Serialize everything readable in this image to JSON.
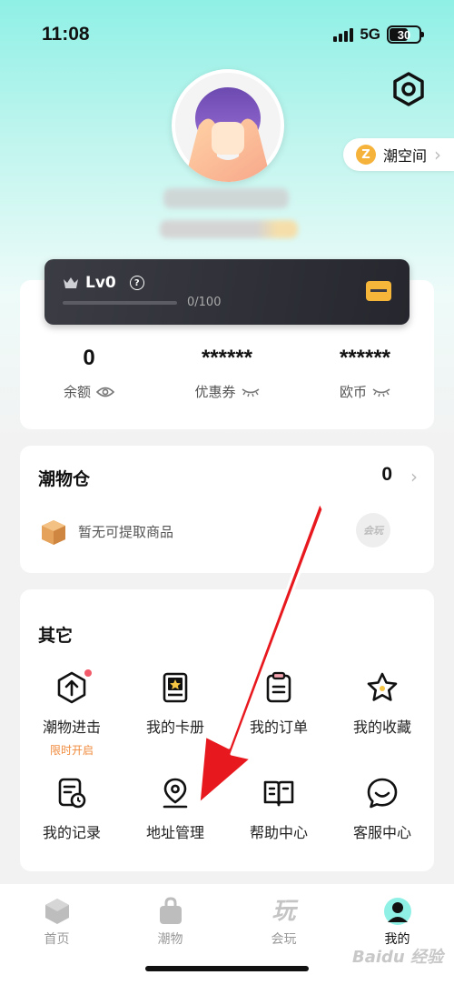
{
  "status_bar": {
    "time": "11:08",
    "network": "5G",
    "battery": "30"
  },
  "profile": {
    "space_link": "潮空间"
  },
  "level_card": {
    "level": "Lv0",
    "progress_text": "0/100",
    "progress": 0
  },
  "wallet": {
    "items": [
      {
        "value": "0",
        "label": "余额"
      },
      {
        "value": "******",
        "label": "优惠券"
      },
      {
        "value": "******",
        "label": "欧币"
      }
    ]
  },
  "warehouse": {
    "title": "潮物仓",
    "count": "0",
    "empty_text": "暂无可提取商品",
    "logo_text": "会玩"
  },
  "other": {
    "title": "其它",
    "items": [
      {
        "label": "潮物进击",
        "sub": "限时开启",
        "icon": "hexagon-arrow-icon"
      },
      {
        "label": "我的卡册",
        "icon": "card-album-icon"
      },
      {
        "label": "我的订单",
        "icon": "order-clipboard-icon"
      },
      {
        "label": "我的收藏",
        "icon": "star-icon"
      },
      {
        "label": "我的记录",
        "icon": "record-icon"
      },
      {
        "label": "地址管理",
        "icon": "location-pin-icon"
      },
      {
        "label": "帮助中心",
        "icon": "book-icon"
      },
      {
        "label": "客服中心",
        "icon": "chat-icon"
      }
    ]
  },
  "tabbar": {
    "tabs": [
      {
        "label": "首页",
        "icon": "home-cube-icon"
      },
      {
        "label": "潮物",
        "icon": "shopping-bag-icon"
      },
      {
        "label": "会玩",
        "icon": "play-text-icon"
      },
      {
        "label": "我的",
        "icon": "profile-icon"
      }
    ],
    "active": 3
  },
  "watermark": "Baidu 经验",
  "colors": {
    "accent": "#f5b63a",
    "highlight": "#f08a3c",
    "arrow": "#e8191e",
    "teal": "#8ff0e6"
  }
}
